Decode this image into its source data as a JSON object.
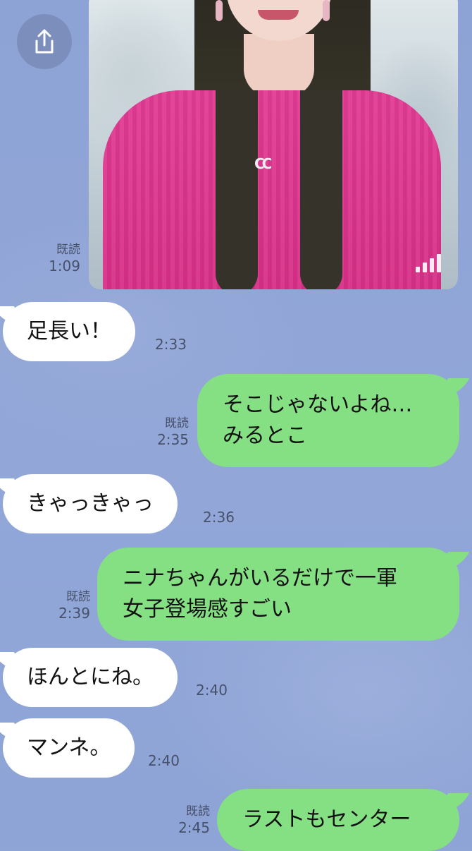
{
  "chat": {
    "photo": {
      "read_label": "既読",
      "time": "1:09",
      "logo_text": "CC"
    },
    "messages": [
      {
        "side": "in",
        "text": "足長い！",
        "time": "2:33"
      },
      {
        "side": "out",
        "lines": [
          "そこじゃないよね…",
          "みるとこ"
        ],
        "read_label": "既読",
        "time": "2:35"
      },
      {
        "side": "in",
        "text": "きゃっきゃっ",
        "time": "2:36"
      },
      {
        "side": "out",
        "lines": [
          "ニナちゃんがいるだけで一軍",
          "女子登場感すごい"
        ],
        "read_label": "既読",
        "time": "2:39"
      },
      {
        "side": "in",
        "text": "ほんとにね。",
        "time": "2:40"
      },
      {
        "side": "in",
        "text": "マンネ。",
        "time": "2:40"
      },
      {
        "side": "out",
        "text": "ラストもセンター",
        "read_label": "既読",
        "time": "2:45"
      }
    ]
  },
  "icons": {
    "share": "share-upload-icon",
    "quality": "signal-bars-icon"
  },
  "colors": {
    "background": "#8fa5d6",
    "incoming_bubble": "#ffffff",
    "outgoing_bubble": "#85e083",
    "meta_text": "#46506a"
  }
}
